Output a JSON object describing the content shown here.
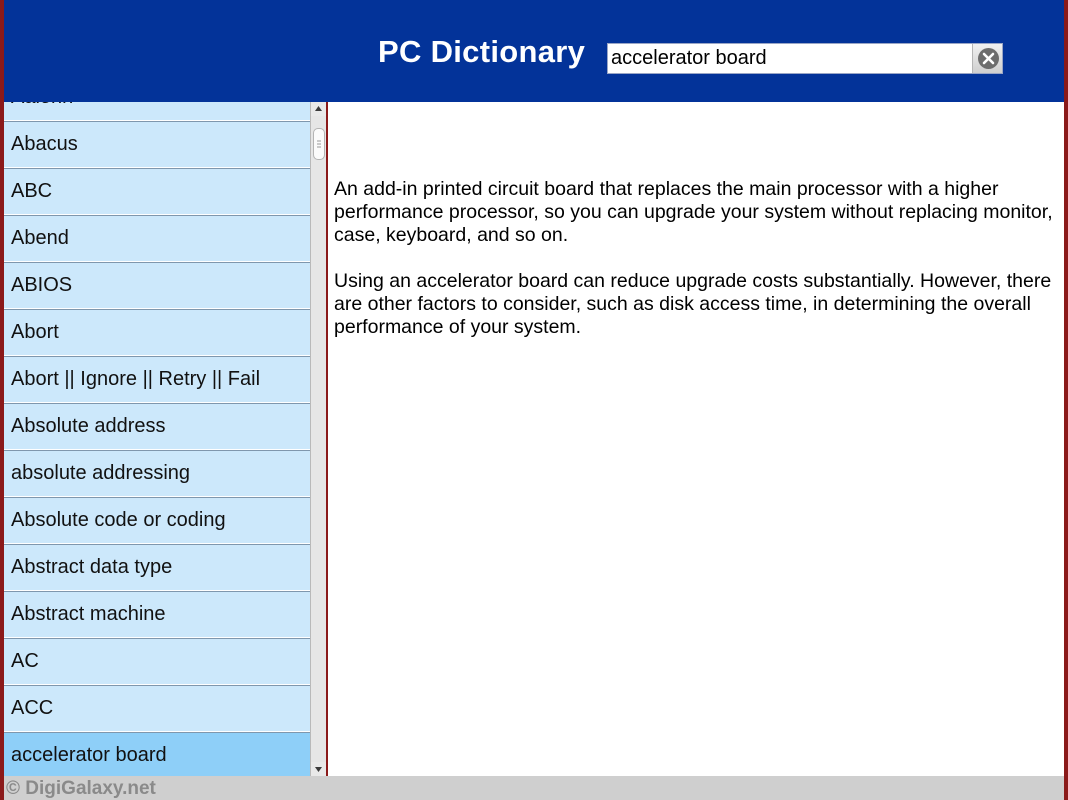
{
  "header": {
    "title": "PC Dictionary"
  },
  "search": {
    "value": "accelerator board",
    "clear_icon": "clear-circle-x-icon"
  },
  "sidebar": {
    "items": [
      {
        "label": "Aalohh",
        "selected": false
      },
      {
        "label": "Abacus",
        "selected": false
      },
      {
        "label": "ABC",
        "selected": false
      },
      {
        "label": "Abend",
        "selected": false
      },
      {
        "label": "ABIOS",
        "selected": false
      },
      {
        "label": "Abort",
        "selected": false
      },
      {
        "label": "Abort || Ignore || Retry || Fail",
        "selected": false
      },
      {
        "label": "Absolute address",
        "selected": false
      },
      {
        "label": "absolute addressing",
        "selected": false
      },
      {
        "label": "Absolute code or coding",
        "selected": false
      },
      {
        "label": "Abstract data type",
        "selected": false
      },
      {
        "label": "Abstract machine",
        "selected": false
      },
      {
        "label": "AC",
        "selected": false
      },
      {
        "label": "ACC",
        "selected": false
      },
      {
        "label": "accelerator board",
        "selected": true
      }
    ]
  },
  "content": {
    "paragraphs": [
      "An add-in printed circuit board that replaces the main processor with a higher performance processor, so you can upgrade your system without replacing monitor, case, keyboard, and so on.",
      "Using an accelerator board can reduce upgrade costs substantially. However, there are other factors to consider, such as disk access time, in determining the overall performance of your system."
    ]
  },
  "footer": {
    "copyright": "© DigiGalaxy.net"
  },
  "colors": {
    "header_bg": "#033399",
    "list_item_bg": "#cce8fb",
    "list_item_selected_bg": "#8ecff8",
    "frame_border": "#8b1a1a"
  }
}
